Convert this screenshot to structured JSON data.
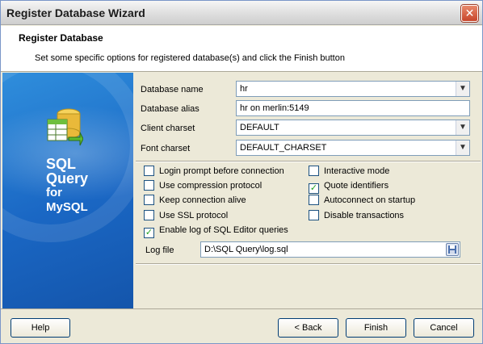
{
  "window": {
    "title": "Register Database Wizard"
  },
  "header": {
    "title": "Register Database",
    "description": "Set some specific options for registered database(s) and click the Finish button"
  },
  "sidebar": {
    "line1": "SQL",
    "line2": "Query",
    "line3": "for",
    "line4": "MySQL"
  },
  "form": {
    "database_name": {
      "label": "Database name",
      "value": "hr"
    },
    "database_alias": {
      "label": "Database alias",
      "value": "hr on merlin:5149"
    },
    "client_charset": {
      "label": "Client charset",
      "value": "DEFAULT"
    },
    "font_charset": {
      "label": "Font charset",
      "value": "DEFAULT_CHARSET"
    }
  },
  "options": {
    "login_prompt": {
      "label": "Login prompt before connection",
      "checked": false
    },
    "use_compression": {
      "label": "Use compression protocol",
      "checked": false
    },
    "keep_alive": {
      "label": "Keep connection alive",
      "checked": false
    },
    "use_ssl": {
      "label": "Use SSL protocol",
      "checked": false
    },
    "enable_log": {
      "label": "Enable log of SQL Editor queries",
      "checked": true
    },
    "interactive_mode": {
      "label": "Interactive mode",
      "checked": false
    },
    "quote_identifiers": {
      "label": "Quote identifiers",
      "checked": true
    },
    "autoconnect": {
      "label": "Autoconnect on startup",
      "checked": false
    },
    "disable_transactions": {
      "label": "Disable transactions",
      "checked": false
    }
  },
  "log_file": {
    "label": "Log file",
    "value": "D:\\SQL Query\\log.sql"
  },
  "footer": {
    "help": "Help",
    "back": "< Back",
    "finish": "Finish",
    "cancel": "Cancel"
  },
  "icons": {
    "close": "close-icon",
    "dropdown": "chevron-down-icon",
    "save": "save-icon"
  }
}
